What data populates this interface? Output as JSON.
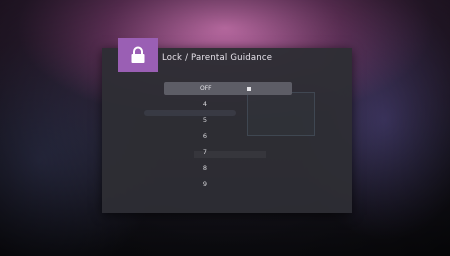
{
  "dialog": {
    "title": "Lock / Parental Guidance",
    "lock_icon": "lock-icon",
    "accent_color": "#9a5fb4",
    "selected_option": "OFF",
    "options": [
      "4",
      "5",
      "6",
      "7",
      "8",
      "9"
    ]
  }
}
